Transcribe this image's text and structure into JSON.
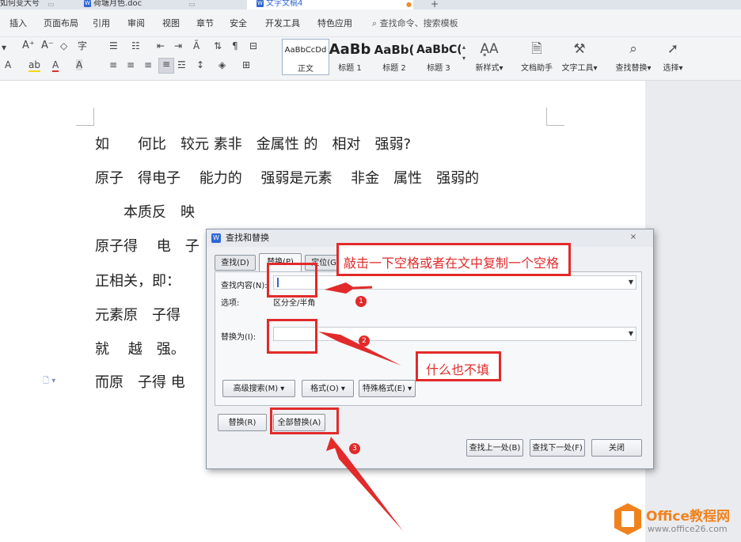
{
  "tabs": [
    {
      "label": "如何变大号"
    },
    {
      "label": "荷塘月色.doc"
    },
    {
      "label": "文字文稿4"
    }
  ],
  "menu": [
    "插入",
    "页面布局",
    "引用",
    "审阅",
    "视图",
    "章节",
    "安全",
    "开发工具",
    "特色应用",
    "查找命令、搜索模板"
  ],
  "ribbon": {
    "styles": [
      {
        "sample": "AaBbCcDd",
        "label": "正文"
      },
      {
        "sample": "AaBb",
        "label": "标题 1"
      },
      {
        "sample": "AaBb(",
        "label": "标题 2"
      },
      {
        "sample": "AaBbC(",
        "label": "标题 3"
      }
    ],
    "tools": [
      {
        "label": "新样式",
        "icon": "new-style-icon"
      },
      {
        "label": "文档助手",
        "icon": "doc-assistant-icon"
      },
      {
        "label": "文字工具",
        "icon": "wrench-icon"
      },
      {
        "label": "查找替换",
        "icon": "search-icon"
      },
      {
        "label": "选择",
        "icon": "cursor-icon"
      }
    ]
  },
  "document": {
    "lines": [
      "如　　何比　较元 素非　金属性 的　相对　强弱?",
      "原子　得电子　 能力的　 强弱是元素　 非金　属性　强弱的",
      "　　本质反　映",
      "原子得　 电　子",
      "正相关，即：",
      "元素原　子得",
      "就　 越　强。",
      "而原　子得 电"
    ]
  },
  "dialog": {
    "title": "查找和替换",
    "tabs": [
      "查找(D)",
      "替换(P)",
      "定位(G)"
    ],
    "find_label": "查找内容(N):",
    "find_value": "",
    "options_label": "选项:",
    "options_value": "区分全/半角",
    "replace_label": "替换为(I):",
    "replace_value": "",
    "buttons": {
      "advanced": "高级搜索(M) ▾",
      "format": "格式(O) ▾",
      "special": "特殊格式(E) ▾",
      "replace": "替换(R)",
      "replace_all": "全部替换(A)",
      "find_prev": "查找上一处(B)",
      "find_next": "查找下一处(F)",
      "close": "关闭"
    }
  },
  "annotations": {
    "note1": "敲击一下空格或者在文中复制一个空格",
    "note2": "什么也不填",
    "nums": [
      "1",
      "2",
      "3"
    ]
  },
  "logo": {
    "brand": "Office教程网",
    "url": "www.office26.com"
  }
}
